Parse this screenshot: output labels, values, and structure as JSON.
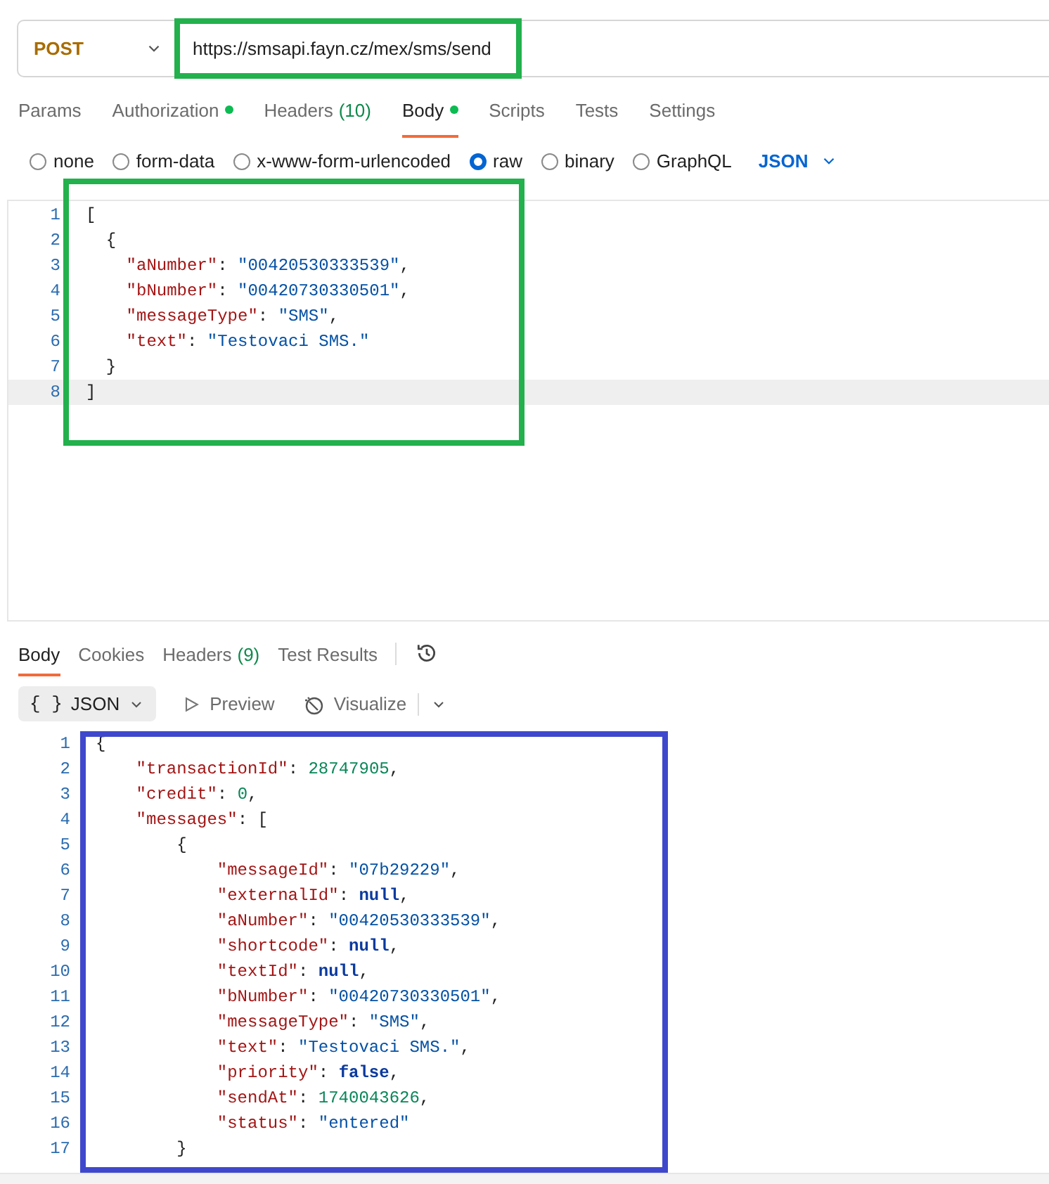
{
  "request": {
    "method": "POST",
    "url": "https://smsapi.fayn.cz/mex/sms/send"
  },
  "tabs": [
    {
      "label": "Params",
      "selected": false,
      "dot": false
    },
    {
      "label": "Authorization",
      "selected": false,
      "dot": true
    },
    {
      "label": "Headers",
      "count": "(10)",
      "selected": false,
      "dot": false
    },
    {
      "label": "Body",
      "selected": true,
      "dot": true
    },
    {
      "label": "Scripts",
      "selected": false,
      "dot": false
    },
    {
      "label": "Tests",
      "selected": false,
      "dot": false
    },
    {
      "label": "Settings",
      "selected": false,
      "dot": false
    }
  ],
  "body_types": [
    {
      "label": "none",
      "selected": false
    },
    {
      "label": "form-data",
      "selected": false
    },
    {
      "label": "x-www-form-urlencoded",
      "selected": false
    },
    {
      "label": "raw",
      "selected": true
    },
    {
      "label": "binary",
      "selected": false
    },
    {
      "label": "GraphQL",
      "selected": false
    }
  ],
  "body_format": "JSON",
  "request_body": [
    {
      "number": "1",
      "active": false,
      "tokens": [
        {
          "kind": "punct",
          "text": "["
        }
      ],
      "children": [
        {
          "number": "2",
          "active": false,
          "tokens": [
            {
              "kind": "punct",
              "text": "{"
            }
          ],
          "children": [
            {
              "number": "3",
              "active": false,
              "tokens": [
                {
                  "kind": "key",
                  "text": "\"aNumber\""
                },
                {
                  "kind": "punct",
                  "text": ":"
                },
                {
                  "kind": "string",
                  "text": "\"00420530333539\""
                },
                {
                  "kind": "punct",
                  "text": ","
                }
              ]
            },
            {
              "number": "4",
              "active": false,
              "tokens": [
                {
                  "kind": "key",
                  "text": "\"bNumber\""
                },
                {
                  "kind": "punct",
                  "text": ":"
                },
                {
                  "kind": "string",
                  "text": "\"00420730330501\""
                },
                {
                  "kind": "punct",
                  "text": ","
                }
              ]
            },
            {
              "number": "5",
              "active": false,
              "tokens": [
                {
                  "kind": "key",
                  "text": "\"messageType\""
                },
                {
                  "kind": "punct",
                  "text": ":"
                },
                {
                  "kind": "string",
                  "text": "\"SMS\""
                },
                {
                  "kind": "punct",
                  "text": ","
                }
              ]
            },
            {
              "number": "6",
              "active": false,
              "tokens": [
                {
                  "kind": "key",
                  "text": "\"text\""
                },
                {
                  "kind": "punct",
                  "text": ":"
                },
                {
                  "kind": "string",
                  "text": "\"Testovaci SMS.\""
                }
              ]
            }
          ]
        },
        {
          "number": "7",
          "active": false,
          "tokens": [
            {
              "kind": "punct",
              "text": "}"
            }
          ]
        }
      ]
    },
    {
      "number": "8",
      "active": true,
      "tokens": [
        {
          "kind": "punct",
          "text": "]"
        }
      ]
    }
  ],
  "response_tabs": [
    {
      "label": "Body",
      "selected": true
    },
    {
      "label": "Cookies",
      "selected": false
    },
    {
      "label": "Headers",
      "count": "(9)",
      "selected": false
    },
    {
      "label": "Test Results",
      "selected": false
    }
  ],
  "response_toolbar": {
    "format": "JSON",
    "braces": "{ }",
    "preview": "Preview",
    "visualize": "Visualize"
  },
  "response_body": [
    {
      "number": "1",
      "tokens": [
        {
          "kind": "punct",
          "text": "{"
        }
      ],
      "children": [
        {
          "number": "2",
          "tokens": [
            {
              "kind": "key",
              "text": "\"transactionId\""
            },
            {
              "kind": "punct",
              "text": ":"
            },
            {
              "kind": "number",
              "text": "28747905"
            },
            {
              "kind": "punct",
              "text": ","
            }
          ]
        },
        {
          "number": "3",
          "tokens": [
            {
              "kind": "key",
              "text": "\"credit\""
            },
            {
              "kind": "punct",
              "text": ":"
            },
            {
              "kind": "number",
              "text": "0"
            },
            {
              "kind": "punct",
              "text": ","
            }
          ]
        },
        {
          "number": "4",
          "tokens": [
            {
              "kind": "key",
              "text": "\"messages\""
            },
            {
              "kind": "punct",
              "text": ":"
            },
            {
              "kind": "punct",
              "text": "["
            }
          ],
          "children": [
            {
              "number": "5",
              "tokens": [
                {
                  "kind": "punct",
                  "text": "{"
                }
              ],
              "children": [
                {
                  "number": "6",
                  "tokens": [
                    {
                      "kind": "key",
                      "text": "\"messageId\""
                    },
                    {
                      "kind": "punct",
                      "text": ":"
                    },
                    {
                      "kind": "string",
                      "text": "\"07b29229\""
                    },
                    {
                      "kind": "punct",
                      "text": ","
                    }
                  ]
                },
                {
                  "number": "7",
                  "tokens": [
                    {
                      "kind": "key",
                      "text": "\"externalId\""
                    },
                    {
                      "kind": "punct",
                      "text": ":"
                    },
                    {
                      "kind": "keyword",
                      "text": "null"
                    },
                    {
                      "kind": "punct",
                      "text": ","
                    }
                  ]
                },
                {
                  "number": "8",
                  "tokens": [
                    {
                      "kind": "key",
                      "text": "\"aNumber\""
                    },
                    {
                      "kind": "punct",
                      "text": ":"
                    },
                    {
                      "kind": "string",
                      "text": "\"00420530333539\""
                    },
                    {
                      "kind": "punct",
                      "text": ","
                    }
                  ]
                },
                {
                  "number": "9",
                  "tokens": [
                    {
                      "kind": "key",
                      "text": "\"shortcode\""
                    },
                    {
                      "kind": "punct",
                      "text": ":"
                    },
                    {
                      "kind": "keyword",
                      "text": "null"
                    },
                    {
                      "kind": "punct",
                      "text": ","
                    }
                  ]
                },
                {
                  "number": "10",
                  "tokens": [
                    {
                      "kind": "key",
                      "text": "\"textId\""
                    },
                    {
                      "kind": "punct",
                      "text": ":"
                    },
                    {
                      "kind": "keyword",
                      "text": "null"
                    },
                    {
                      "kind": "punct",
                      "text": ","
                    }
                  ]
                },
                {
                  "number": "11",
                  "tokens": [
                    {
                      "kind": "key",
                      "text": "\"bNumber\""
                    },
                    {
                      "kind": "punct",
                      "text": ":"
                    },
                    {
                      "kind": "string",
                      "text": "\"00420730330501\""
                    },
                    {
                      "kind": "punct",
                      "text": ","
                    }
                  ]
                },
                {
                  "number": "12",
                  "tokens": [
                    {
                      "kind": "key",
                      "text": "\"messageType\""
                    },
                    {
                      "kind": "punct",
                      "text": ":"
                    },
                    {
                      "kind": "string",
                      "text": "\"SMS\""
                    },
                    {
                      "kind": "punct",
                      "text": ","
                    }
                  ]
                },
                {
                  "number": "13",
                  "tokens": [
                    {
                      "kind": "key",
                      "text": "\"text\""
                    },
                    {
                      "kind": "punct",
                      "text": ":"
                    },
                    {
                      "kind": "string",
                      "text": "\"Testovaci SMS.\""
                    },
                    {
                      "kind": "punct",
                      "text": ","
                    }
                  ]
                },
                {
                  "number": "14",
                  "tokens": [
                    {
                      "kind": "key",
                      "text": "\"priority\""
                    },
                    {
                      "kind": "punct",
                      "text": ":"
                    },
                    {
                      "kind": "keyword",
                      "text": "false"
                    },
                    {
                      "kind": "punct",
                      "text": ","
                    }
                  ]
                },
                {
                  "number": "15",
                  "tokens": [
                    {
                      "kind": "key",
                      "text": "\"sendAt\""
                    },
                    {
                      "kind": "punct",
                      "text": ":"
                    },
                    {
                      "kind": "number",
                      "text": "1740043626"
                    },
                    {
                      "kind": "punct",
                      "text": ","
                    }
                  ]
                },
                {
                  "number": "16",
                  "tokens": [
                    {
                      "kind": "key",
                      "text": "\"status\""
                    },
                    {
                      "kind": "punct",
                      "text": ":"
                    },
                    {
                      "kind": "string",
                      "text": "\"entered\""
                    }
                  ]
                }
              ]
            },
            {
              "number": "17",
              "tokens": [
                {
                  "kind": "punct",
                  "text": "}"
                }
              ]
            }
          ]
        }
      ]
    }
  ],
  "annotations": [
    {
      "color": "#22b14c"
    },
    {
      "color": "#22b14c"
    },
    {
      "color": "#3f48cc"
    }
  ]
}
